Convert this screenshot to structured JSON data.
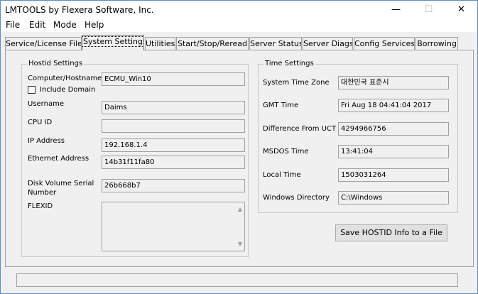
{
  "window": {
    "title": "LMTOOLS by Flexera Software, Inc."
  },
  "controls": {
    "minimize": "—",
    "maximize": "☐",
    "close": "✕"
  },
  "menu": [
    "File",
    "Edit",
    "Mode",
    "Help"
  ],
  "tabs": [
    "Service/License File",
    "System Settings",
    "Utilities",
    "Start/Stop/Reread",
    "Server Status",
    "Server Diags",
    "Config Services",
    "Borrowing"
  ],
  "active_tab": "System Settings",
  "hostid": {
    "title": "Hostid Settings",
    "computer_label": "Computer/Hostname",
    "computer_value": "ECMU_Win10",
    "include_domain_label": "Include Domain",
    "username_label": "Username",
    "username_value": "Daims",
    "cpu_id_label": "CPU ID",
    "cpu_id_value": "",
    "ip_label": "IP Address",
    "ip_value": "192.168.1.4",
    "ethernet_label": "Ethernet Address",
    "ethernet_value": "14b31f11fa80",
    "disk_label_line1": "Disk Volume Serial",
    "disk_label_line2": "Number",
    "disk_value": "26b668b7",
    "flexid_label": "FLEXID"
  },
  "time": {
    "title": "Time Settings",
    "tz_label": "System Time Zone",
    "tz_value": "대한민국 표준시",
    "gmt_label": "GMT Time",
    "gmt_value": "Fri Aug 18 04:41:04 2017",
    "diff_label": "Difference From UCT",
    "diff_value": "4294966756",
    "msdos_label": "MSDOS Time",
    "msdos_value": "13:41:04",
    "local_label": "Local Time",
    "local_value": "1503031264",
    "windir_label": "Windows Directory",
    "windir_value": "C:\\Windows"
  },
  "save_button": "Save HOSTID Info to a File",
  "icons": {
    "scroll_up": "▲",
    "scroll_down": "▼"
  }
}
